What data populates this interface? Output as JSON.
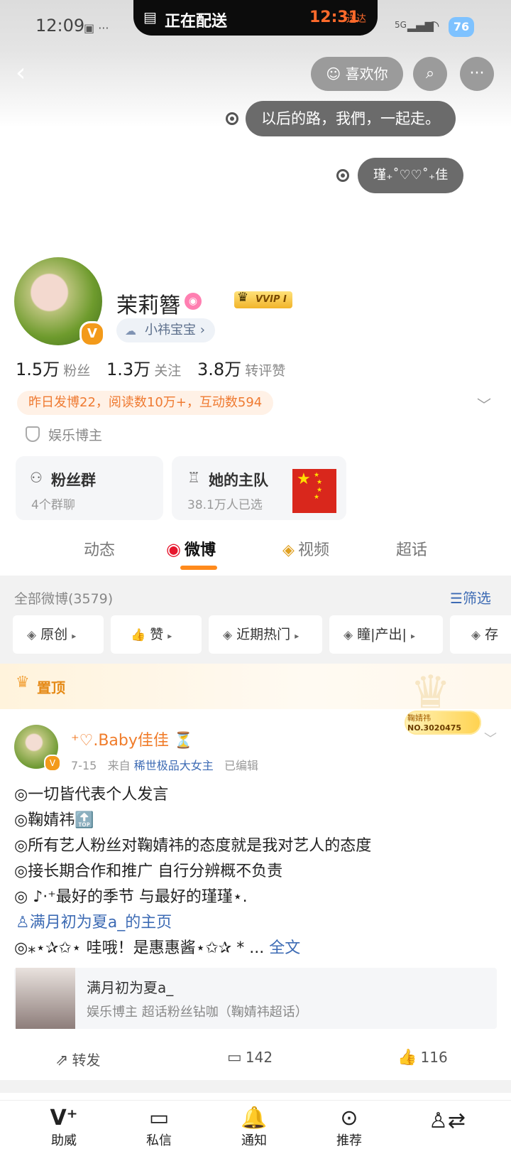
{
  "status": {
    "time": "12:09",
    "network": "5G",
    "battery": "76"
  },
  "delivery": {
    "label": "正在配送",
    "eta": "12:31",
    "eta_suffix": "送达"
  },
  "header": {
    "like_label": "喜欢你"
  },
  "bubbles": [
    "以后的路，我們，一起走。",
    "瑾₊˚♡♡˚₊佳"
  ],
  "profile": {
    "nickname": "茉莉簪",
    "vip_label": "VVIP I",
    "tag": "小祎宝宝",
    "followers": "1.5万",
    "followers_label": "粉丝",
    "following": "1.3万",
    "following_label": "关注",
    "engagements": "3.8万",
    "engagements_label": "转评赞",
    "summary": "昨日发博22，阅读数10万+，互动数594",
    "category": "娱乐博主"
  },
  "cards": [
    {
      "title": "粉丝群",
      "sub": "4个群聊"
    },
    {
      "title": "她的主队",
      "sub": "38.1万人已选"
    }
  ],
  "tabs": [
    "动态",
    "微博",
    "视频",
    "超话"
  ],
  "filter": {
    "all_label": "全部微博(3579)",
    "filter_label": "筛选"
  },
  "chips": [
    "原创",
    "赞",
    "近期热门",
    "瞳|产出|",
    "存"
  ],
  "pinned": {
    "label": "置顶"
  },
  "post": {
    "author": "⁺♡.Baby佳佳 ⏳",
    "date": "7-15",
    "from_prefix": "来自",
    "source": "稀世极品大女主",
    "edited": "已编辑",
    "fans_badge_name": "鞠婧祎",
    "fans_badge_no": "NO.3020475",
    "lines": [
      "◎一切皆代表个人发言",
      "◎鞠婧祎🔝",
      "◎所有艺人粉丝对鞠婧祎的态度就是我对艺人的态度",
      "◎接长期合作和推广 自行分辨概不负责",
      "◎ ♪·⁺最好的季节 与最好的瑾瑾⋆.",
      "◎⁎⋆✰✩⋆ 哇哦！是惠惠酱⋆✩✰ * ..."
    ],
    "mention": "满月初为夏a_的主页",
    "full_text": "全文",
    "card_title": "满月初为夏a_",
    "card_desc": "娱乐博主 超话粉丝钻咖（鞠婧祎超话）",
    "repost_label": "转发",
    "comments": "142",
    "likes": "116"
  },
  "bottom_nav": [
    "助威",
    "私信",
    "通知",
    "推荐",
    ""
  ]
}
